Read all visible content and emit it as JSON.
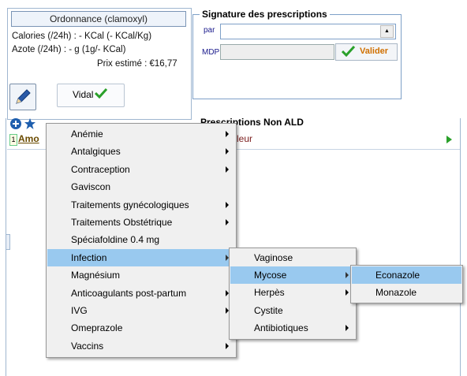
{
  "info": {
    "ordonnance": "Ordonnance (clamoxyl)",
    "calories": "Calories (/24h) : - KCal (- KCal/Kg)",
    "azote": "Azote (/24h) : - g (1g/- KCal)",
    "prix": "Prix estimé : €16,77",
    "vidal": "Vidal"
  },
  "signature": {
    "title": "Signature des prescriptions",
    "par_label": "par",
    "par_value": "",
    "mdp_label": "MDP",
    "mdp_value": "",
    "valider": "Valider"
  },
  "prescriptions": {
    "header": "Prescriptions Non ALD",
    "row_index": "1",
    "row_text": "Amo",
    "row_right": "leur"
  },
  "menu1": [
    {
      "label": "Anémie",
      "submenu": true
    },
    {
      "label": "Antalgiques",
      "submenu": true
    },
    {
      "label": "Contraception",
      "submenu": true
    },
    {
      "label": "Gaviscon",
      "submenu": false
    },
    {
      "label": "Traitements gynécologiques",
      "submenu": true
    },
    {
      "label": "Traitements Obstétrique",
      "submenu": true
    },
    {
      "label": "Spéciafoldine 0.4 mg",
      "submenu": false
    },
    {
      "label": "Infection",
      "submenu": true,
      "selected": true
    },
    {
      "label": "Magnésium",
      "submenu": false
    },
    {
      "label": "Anticoagulants post-partum",
      "submenu": true
    },
    {
      "label": "IVG",
      "submenu": true
    },
    {
      "label": "Omeprazole",
      "submenu": false
    },
    {
      "label": "Vaccins",
      "submenu": true
    }
  ],
  "menu2": [
    {
      "label": "Vaginose",
      "submenu": false
    },
    {
      "label": "Mycose",
      "submenu": true,
      "selected": true
    },
    {
      "label": "Herpès",
      "submenu": true
    },
    {
      "label": "Cystite",
      "submenu": false
    },
    {
      "label": "Antibiotiques",
      "submenu": true
    }
  ],
  "menu3": [
    {
      "label": "Econazole",
      "submenu": false,
      "selected": true
    },
    {
      "label": "Monazole",
      "submenu": false
    }
  ],
  "colors": {
    "accent": "#99c9ef",
    "valider": "#d07000",
    "check": "#2aa02a"
  },
  "icons": {
    "edit": "pencil-icon",
    "add": "plus-circle-icon",
    "favorite": "star-icon",
    "valider": "check-icon"
  }
}
